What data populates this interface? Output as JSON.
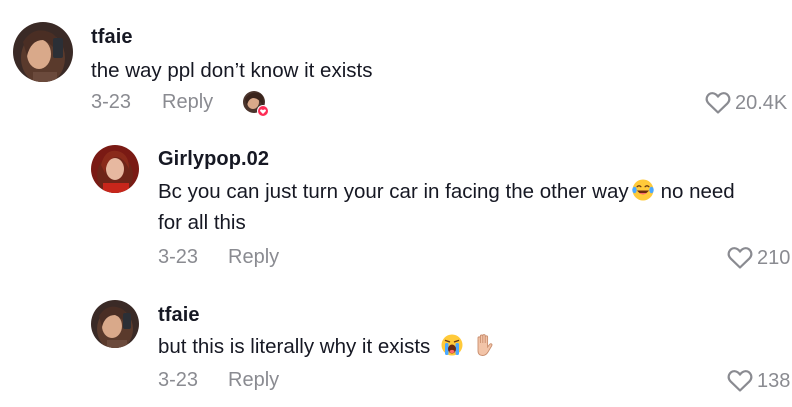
{
  "comments": [
    {
      "username": "tfaie",
      "text": "the way ppl don’t know it exists",
      "date": "3-23",
      "reply_label": "Reply",
      "likes": "20.4K",
      "liked_by_creator": true
    },
    {
      "username": "Girlypop.02",
      "text_line1": "Bc you can just turn your car in facing the other way",
      "text_line1_after": "no need",
      "text_line2": "for all this",
      "emoji": "face-with-tears-of-joy",
      "date": "3-23",
      "reply_label": "Reply",
      "likes": "210"
    },
    {
      "username": "tfaie",
      "text": "but this is literally why it exists",
      "emojis": [
        "loudly-crying-face",
        "raised-hand"
      ],
      "date": "3-23",
      "reply_label": "Reply",
      "likes": "138"
    }
  ],
  "colors": {
    "text": "#161823",
    "muted": "#8a8b91",
    "like_badge": "#fe2c55"
  }
}
